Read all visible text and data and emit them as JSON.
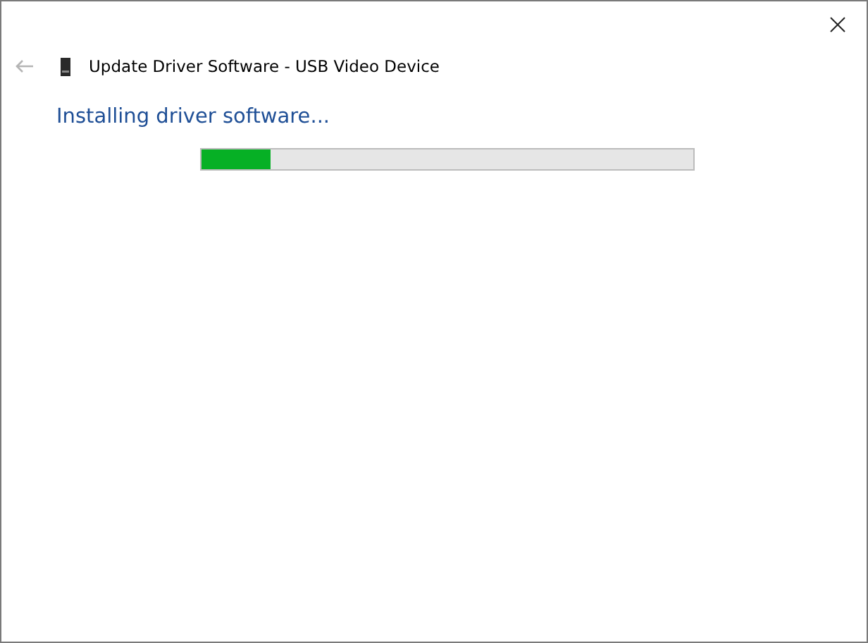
{
  "window": {
    "title": "Update Driver Software - USB Video Device"
  },
  "heading": "Installing driver software...",
  "progress": {
    "level": 0.14
  }
}
